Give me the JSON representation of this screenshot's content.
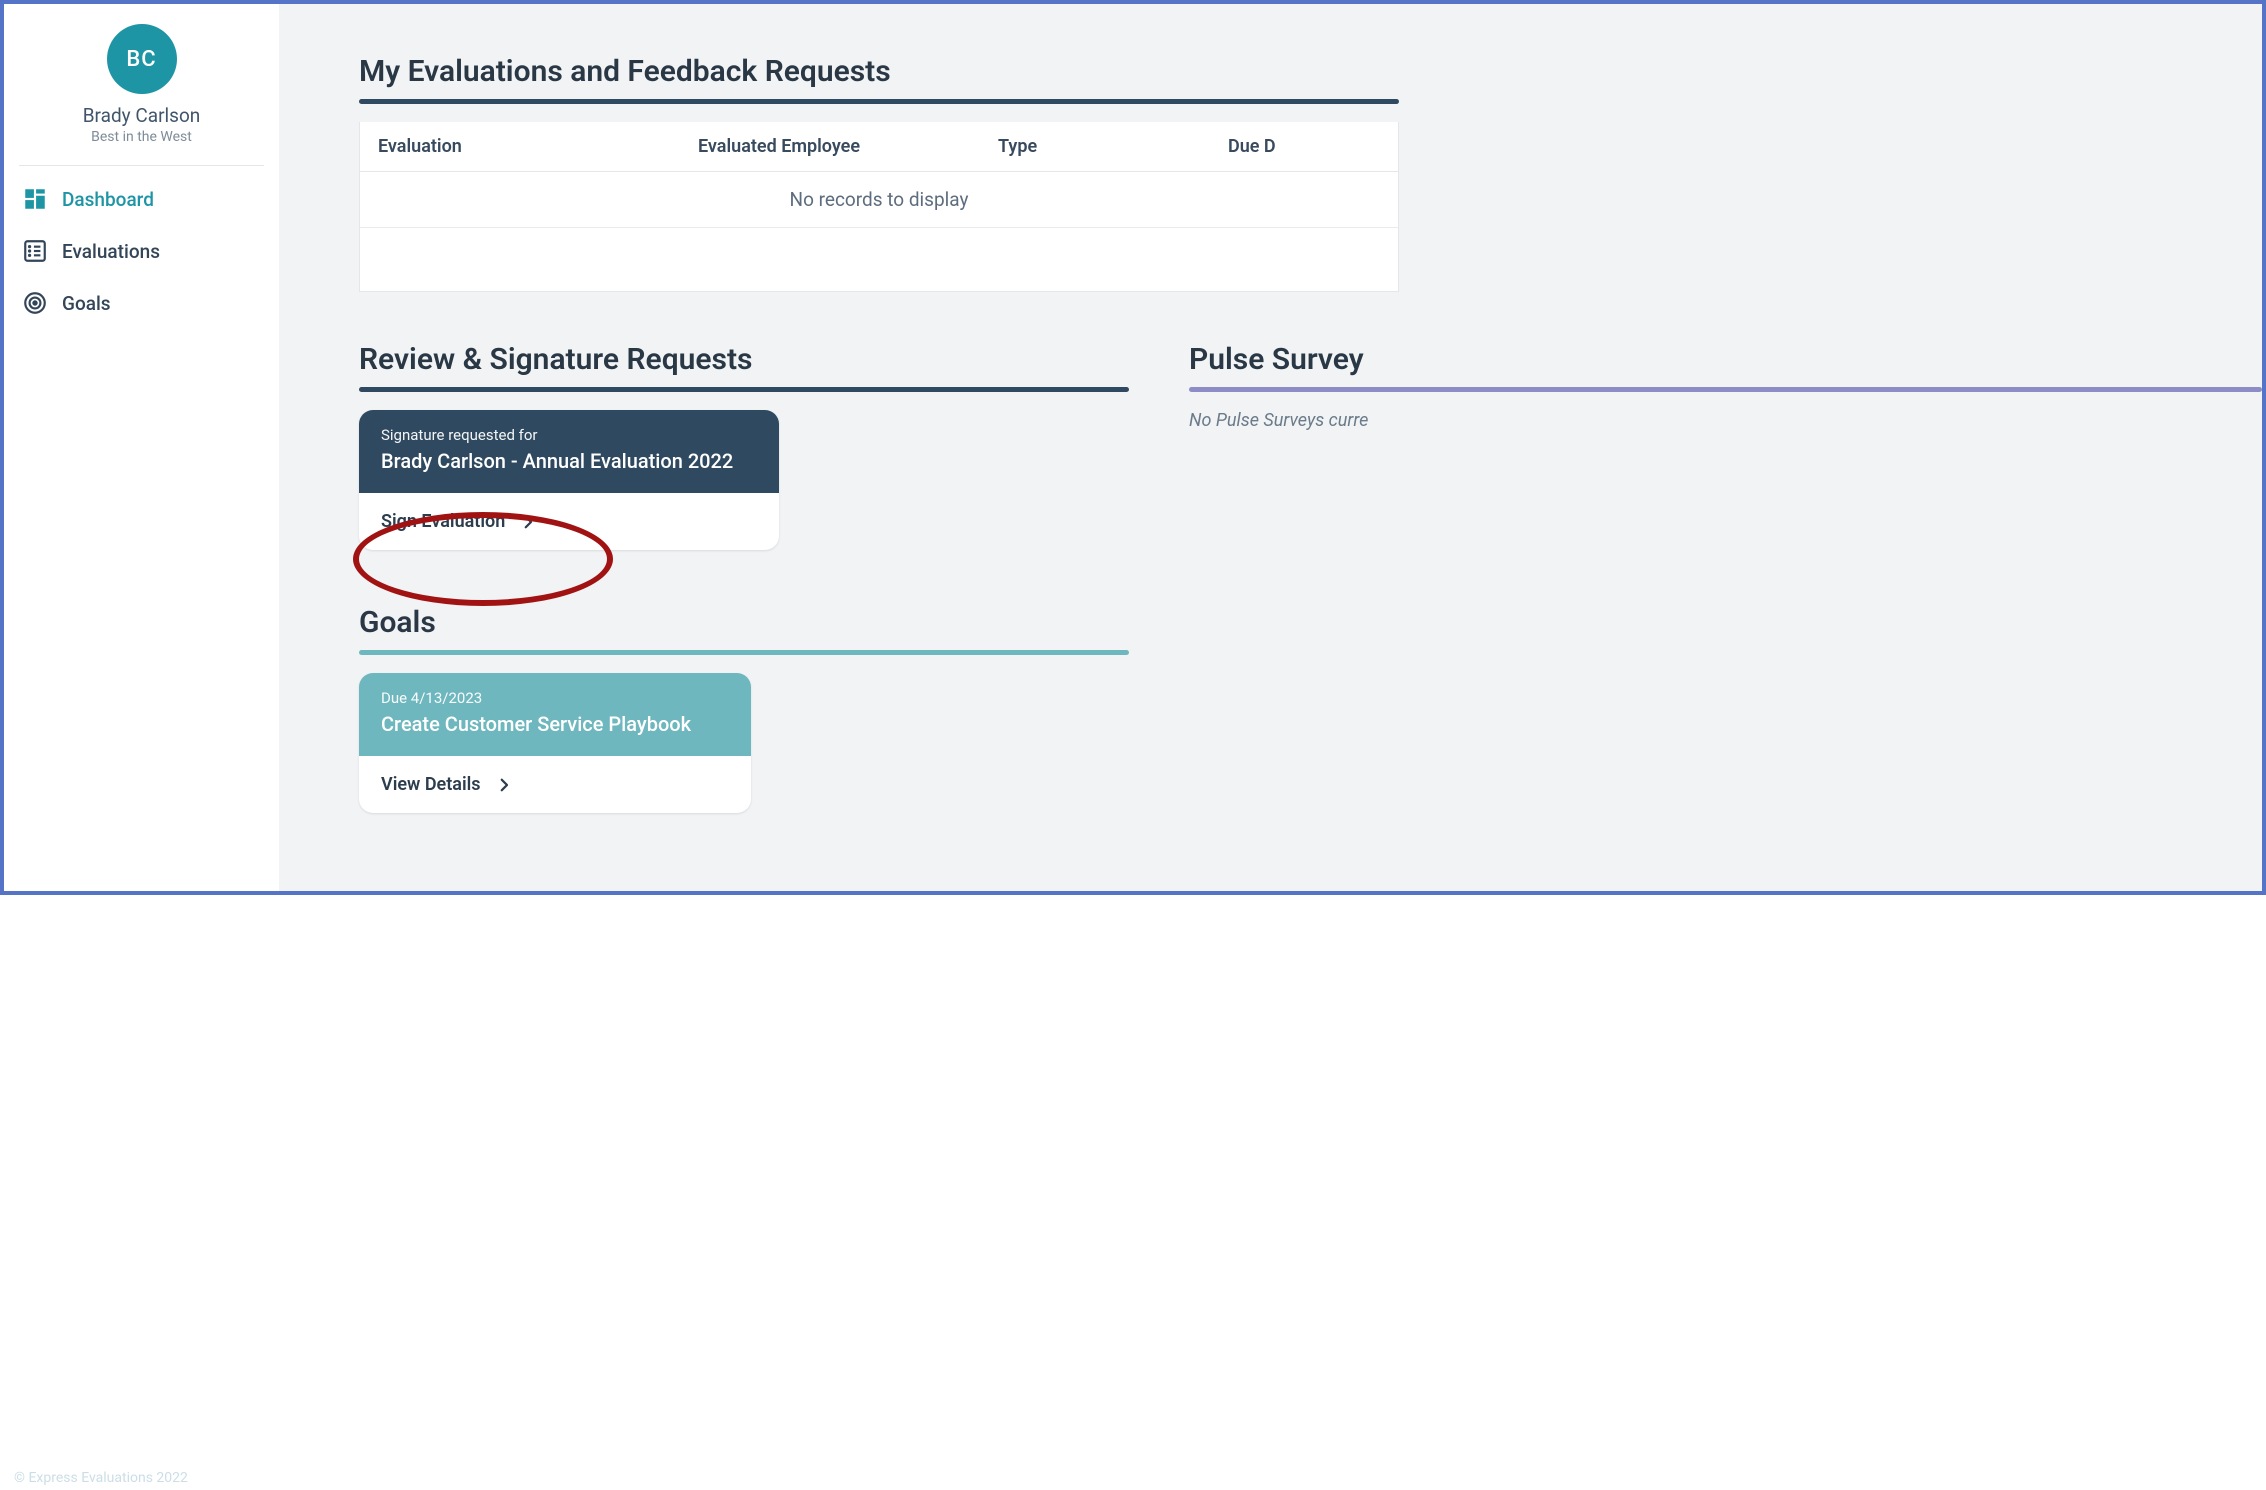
{
  "user": {
    "initials": "BC",
    "name": "Brady Carlson",
    "tagline": "Best in the West"
  },
  "nav": {
    "dashboard": "Dashboard",
    "evaluations": "Evaluations",
    "goals": "Goals"
  },
  "evaluations": {
    "title": "My Evaluations and Feedback Requests",
    "columns": {
      "c1": "Evaluation",
      "c2": "Evaluated Employee",
      "c3": "Type",
      "c4": "Due D"
    },
    "empty": "No records to display"
  },
  "review": {
    "title": "Review & Signature Requests",
    "card": {
      "sub": "Signature requested for",
      "title": "Brady Carlson - Annual Evaluation 2022",
      "action": "Sign Evaluation"
    }
  },
  "pulse": {
    "title": "Pulse Survey",
    "empty": "No Pulse Surveys curre"
  },
  "goals": {
    "title": "Goals",
    "card": {
      "sub": "Due 4/13/2023",
      "title": "Create Customer Service Playbook",
      "action": "View Details"
    }
  },
  "footer": "© Express Evaluations 2022"
}
